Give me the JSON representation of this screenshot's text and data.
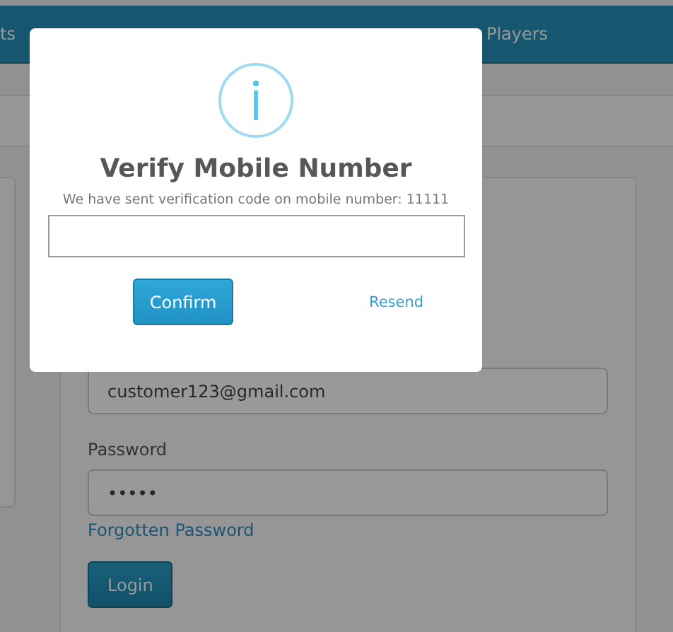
{
  "nav": {
    "items": [
      "ts",
      "Players"
    ]
  },
  "login_form": {
    "email_value": "customer123@gmail.com",
    "password_label": "Password",
    "password_value": "•••••",
    "forgot_link": "Forgotten Password",
    "login_button": "Login"
  },
  "modal": {
    "title": "Verify Mobile Number",
    "message": "We have sent verification code on mobile number: 11111",
    "confirm_button": "Confirm",
    "resend_link": "Resend"
  }
}
